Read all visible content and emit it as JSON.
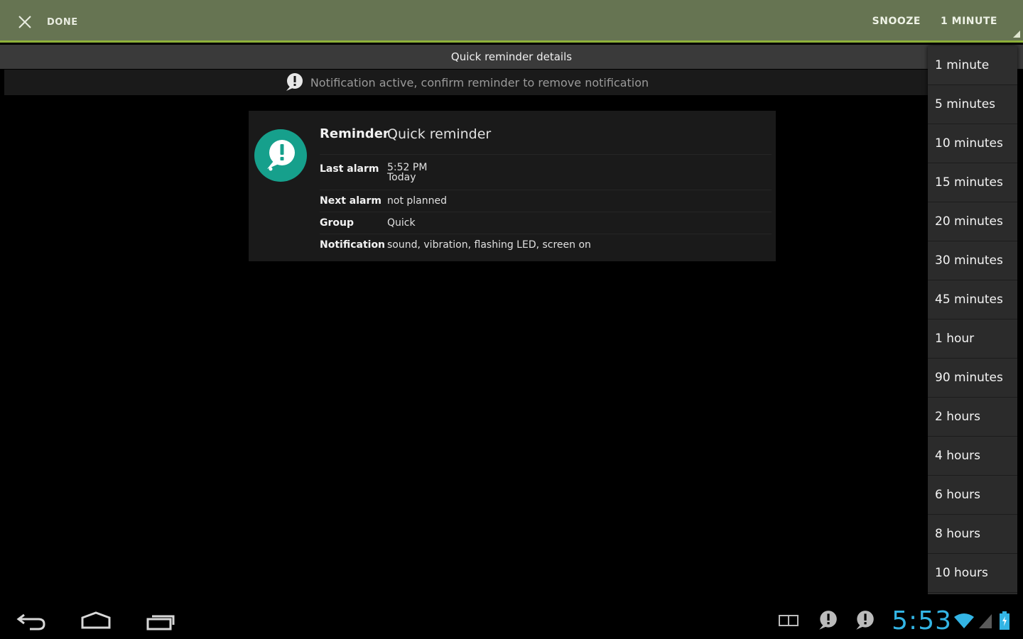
{
  "actionbar": {
    "done_label": "DONE",
    "snooze_label": "SNOOZE",
    "duration_label": "1 MINUTE"
  },
  "title": "Quick reminder details",
  "notice": "Notification active, confirm reminder to remove notification",
  "details": {
    "reminder_label": "Reminder",
    "reminder_value": "Quick reminder",
    "last_alarm_label": "Last alarm",
    "last_alarm_time": "5:52 PM",
    "last_alarm_day": "Today",
    "next_alarm_label": "Next alarm",
    "next_alarm_value": "not planned",
    "group_label": "Group",
    "group_value": "Quick",
    "notification_label": "Notification",
    "notification_value": "sound, vibration, flashing LED, screen on"
  },
  "snooze_options": [
    "1 minute",
    "5 minutes",
    "10 minutes",
    "15 minutes",
    "20 minutes",
    "30 minutes",
    "45 minutes",
    "1 hour",
    "90 minutes",
    "2 hours",
    "4 hours",
    "6 hours",
    "8 hours",
    "10 hours"
  ],
  "status": {
    "clock": "5:53"
  },
  "colors": {
    "actionbar": "#667452",
    "accent_line": "#8fb23a",
    "icon_circle": "#16a08c",
    "clock": "#33b5e5"
  },
  "icons": {
    "done": "close-x-icon",
    "reminder": "speech-bubble-exclamation-icon",
    "nav": [
      "back-icon",
      "home-icon",
      "recent-apps-icon"
    ],
    "status": [
      "gallery-icon",
      "reminder-notification-icon",
      "reminder-notification-icon",
      "wifi-icon",
      "signal-icon",
      "battery-icon"
    ]
  }
}
